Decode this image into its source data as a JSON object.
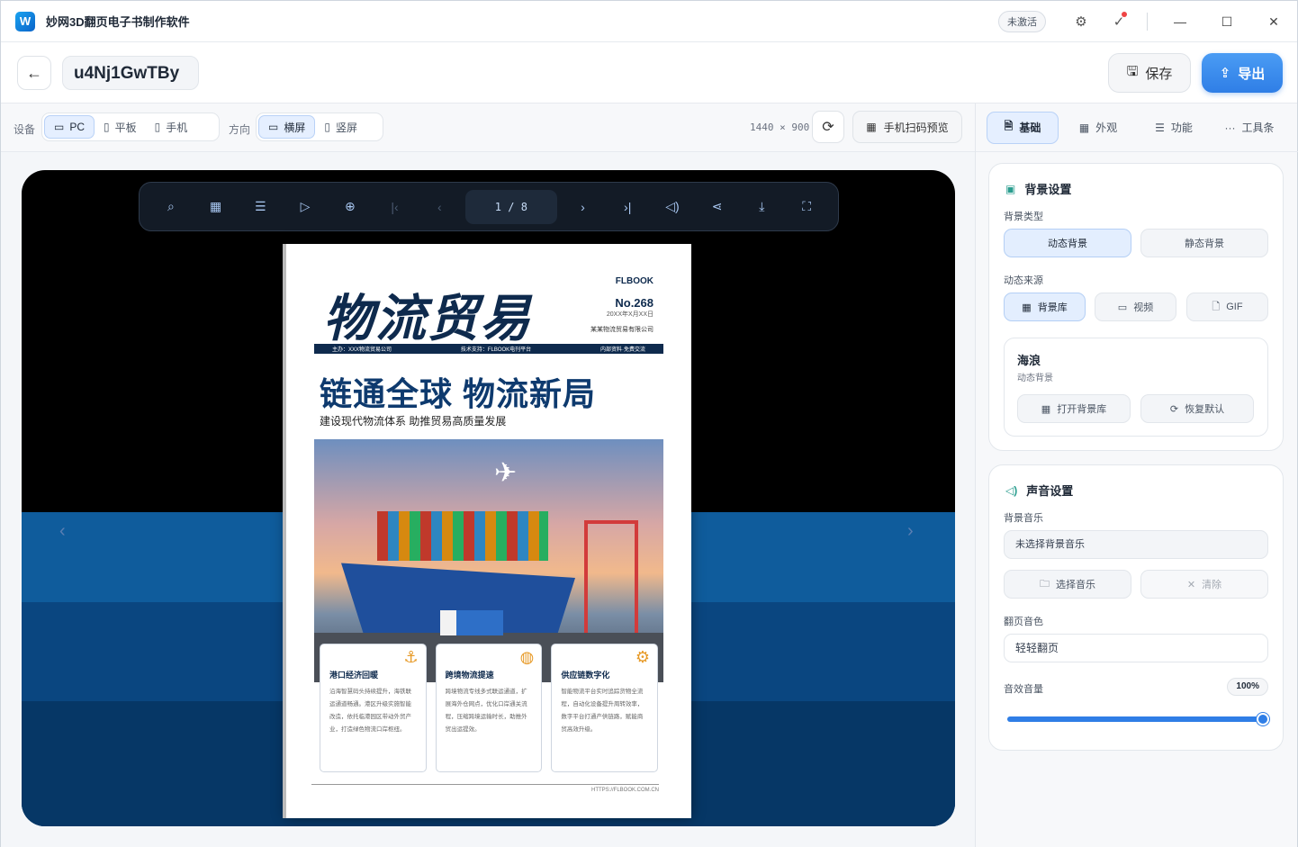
{
  "app": {
    "title": "妙网3D翻页电子书制作软件",
    "logo_letter": "W",
    "status_badge": "未激活"
  },
  "topbar": {
    "document_name": "u4Nj1GwTBy",
    "save_label": "保存",
    "export_label": "导出"
  },
  "toolbar": {
    "device_label": "设备",
    "devices": [
      "PC",
      "平板",
      "手机"
    ],
    "device_selected": "PC",
    "orientation_label": "方向",
    "orientations": [
      "横屏",
      "竖屏"
    ],
    "orientation_selected": "横屏",
    "resolution": "1440 × 900",
    "qr_preview_label": "手机扫码预览"
  },
  "viewer": {
    "page_indicator": "1 / 8"
  },
  "magazine": {
    "title": "物流贸易",
    "logo": "FLBOOK",
    "issue_no": "No.268",
    "date": "20XX年X月XX日",
    "publisher": "某某物流贸易有限公司",
    "strip": [
      "主办：XXX物流贸易公司",
      "技术支持：FLBOOK电刊平台",
      "内部资料·免费交流"
    ],
    "headline": "链通全球 物流新局",
    "subheadline": "建设现代物流体系 助推贸易高质量发展",
    "cards": [
      {
        "title": "港口经济回暖",
        "icon": "anchor-icon",
        "text": "沿海智慧码头持续提升，海铁联运通道畅通。港区升级实施智能改造，依托临港园区带动外贸产业，打造绿色物流口岸枢纽。"
      },
      {
        "title": "跨境物流提速",
        "icon": "globe-icon",
        "text": "跨境物流专线多式联运通道，扩展海外仓网点，优化口岸通关流程，压缩跨境运输时长，助推外贸出运提效。"
      },
      {
        "title": "供应链数字化",
        "icon": "gear-icon",
        "text": "智能物流平台实时追踪货物全流程，自动化设备提升周转效率，数字平台打通产供链路，赋能商贸高效升级。"
      }
    ],
    "url": "HTTPS://FLBOOK.COM.CN"
  },
  "sidebar": {
    "tabs": [
      {
        "label": "基础",
        "icon": "document-icon"
      },
      {
        "label": "外观",
        "icon": "grid-icon"
      },
      {
        "label": "功能",
        "icon": "sliders-icon"
      },
      {
        "label": "工具条",
        "icon": "more-icon"
      }
    ],
    "active_tab": "基础",
    "background": {
      "title": "背景设置",
      "type_label": "背景类型",
      "type_options": [
        "动态背景",
        "静态背景"
      ],
      "type_selected": "动态背景",
      "source_label": "动态来源",
      "source_options": [
        "背景库",
        "视频",
        "GIF"
      ],
      "source_selected": "背景库",
      "current_name": "海浪",
      "current_type": "动态背景",
      "open_library": "打开背景库",
      "restore_default": "恢复默认"
    },
    "sound": {
      "title": "声音设置",
      "music_label": "背景音乐",
      "music_value": "未选择背景音乐",
      "choose_music": "选择音乐",
      "clear": "清除",
      "flip_sound_label": "翻页音色",
      "flip_sound_value": "轻轻翻页",
      "volume_label": "音效音量",
      "volume_display": "100%",
      "volume": 1.0
    }
  },
  "colors": {
    "accent": "#2f7ee6",
    "magazine_navy": "#0e2a4d",
    "wave": "#0f5c9c"
  }
}
